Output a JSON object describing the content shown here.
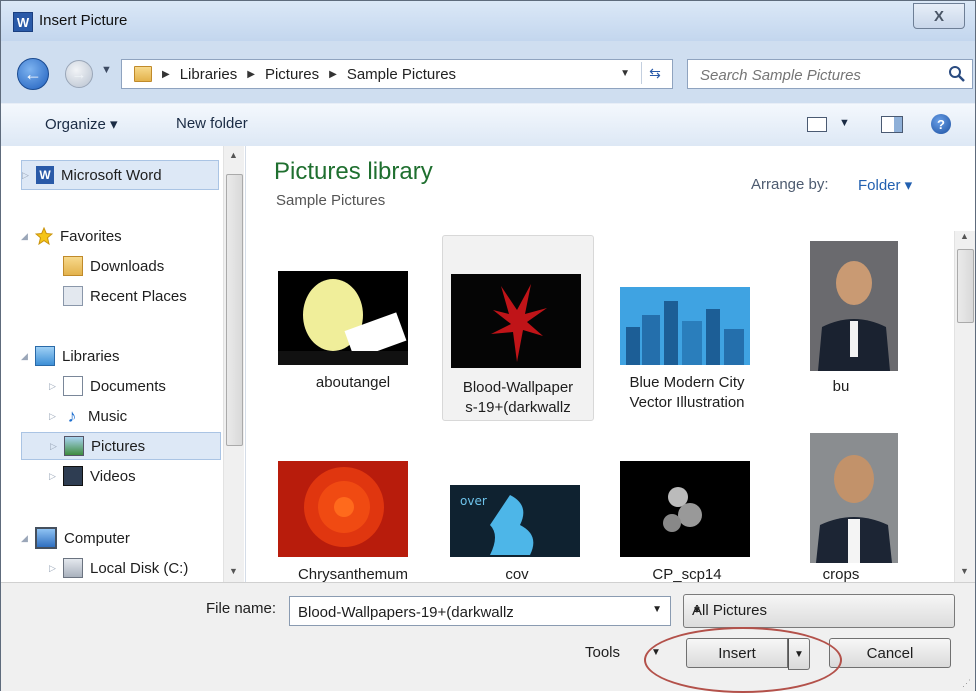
{
  "window": {
    "title": "Insert Picture",
    "app_icon": "W",
    "close": "X"
  },
  "address": {
    "crumbs": [
      "Libraries",
      "Pictures",
      "Sample Pictures"
    ]
  },
  "search": {
    "placeholder": "Search Sample Pictures"
  },
  "toolbar": {
    "organize": "Organize ▾",
    "new_folder": "New folder"
  },
  "nav": {
    "word": "Microsoft Word",
    "favorites": "Favorites",
    "downloads": "Downloads",
    "recent": "Recent Places",
    "libraries": "Libraries",
    "documents": "Documents",
    "music": "Music",
    "pictures": "Pictures",
    "videos": "Videos",
    "computer": "Computer",
    "local_disk": "Local Disk (C:)"
  },
  "content": {
    "title": "Pictures library",
    "subtitle": "Sample Pictures",
    "arrange_label": "Arrange by:",
    "arrange_value": "Folder ▾",
    "files": [
      {
        "name": "aboutangel"
      },
      {
        "name": "Blood-Wallpaper s-19+(darkwallz",
        "line1": "Blood-Wallpaper",
        "line2": "s-19+(darkwallz"
      },
      {
        "name": "Blue Modern City Vector Illustration",
        "line1": "Blue Modern City",
        "line2": "Vector Illustration"
      },
      {
        "name": "bu"
      },
      {
        "name": "Chrysanthemum"
      },
      {
        "name": "cov"
      },
      {
        "name": "CP_scp14"
      },
      {
        "name": "crops"
      }
    ]
  },
  "footer": {
    "file_name_label": "File name:",
    "file_name_value": "Blood-Wallpapers-19+(darkwallz",
    "file_type": "All Pictures",
    "tools": "Tools",
    "insert": "Insert",
    "cancel": "Cancel"
  },
  "colors": {
    "accent": "#2260b0",
    "library_title": "#1f6f2f",
    "highlight": "#b3514a"
  }
}
